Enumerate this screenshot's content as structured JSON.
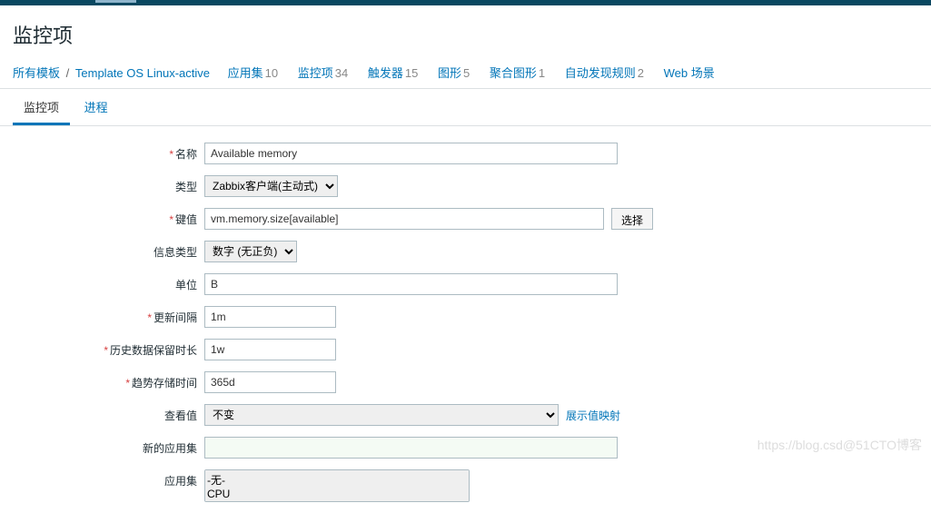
{
  "header": {
    "title": "监控项"
  },
  "breadcrumb": {
    "all_templates": "所有模板",
    "template_name": "Template OS Linux-active"
  },
  "nav": {
    "apps": {
      "label": "应用集",
      "count": "10"
    },
    "items": {
      "label": "监控项",
      "count": "34"
    },
    "triggers": {
      "label": "触发器",
      "count": "15"
    },
    "graphs": {
      "label": "图形",
      "count": "5"
    },
    "screens": {
      "label": "聚合图形",
      "count": "1"
    },
    "discovery": {
      "label": "自动发现规则",
      "count": "2"
    },
    "web": {
      "label": "Web 场景"
    }
  },
  "tabs": {
    "item": "监控项",
    "process": "进程"
  },
  "form": {
    "name": {
      "label": "名称",
      "value": "Available memory"
    },
    "type": {
      "label": "类型",
      "value": "Zabbix客户端(主动式)"
    },
    "key": {
      "label": "键值",
      "value": "vm.memory.size[available]",
      "select_btn": "选择"
    },
    "info_type": {
      "label": "信息类型",
      "value": "数字 (无正负)"
    },
    "unit": {
      "label": "单位",
      "value": "B"
    },
    "interval": {
      "label": "更新间隔",
      "value": "1m"
    },
    "history": {
      "label": "历史数据保留时长",
      "value": "1w"
    },
    "trends": {
      "label": "趋势存储时间",
      "value": "365d"
    },
    "show_value": {
      "label": "查看值",
      "value": "不变",
      "link": "展示值映射"
    },
    "new_app": {
      "label": "新的应用集",
      "value": ""
    },
    "apps": {
      "label": "应用集",
      "options": [
        "-无-",
        "CPU"
      ]
    }
  },
  "watermark": "https://blog.csd@51CTO博客"
}
